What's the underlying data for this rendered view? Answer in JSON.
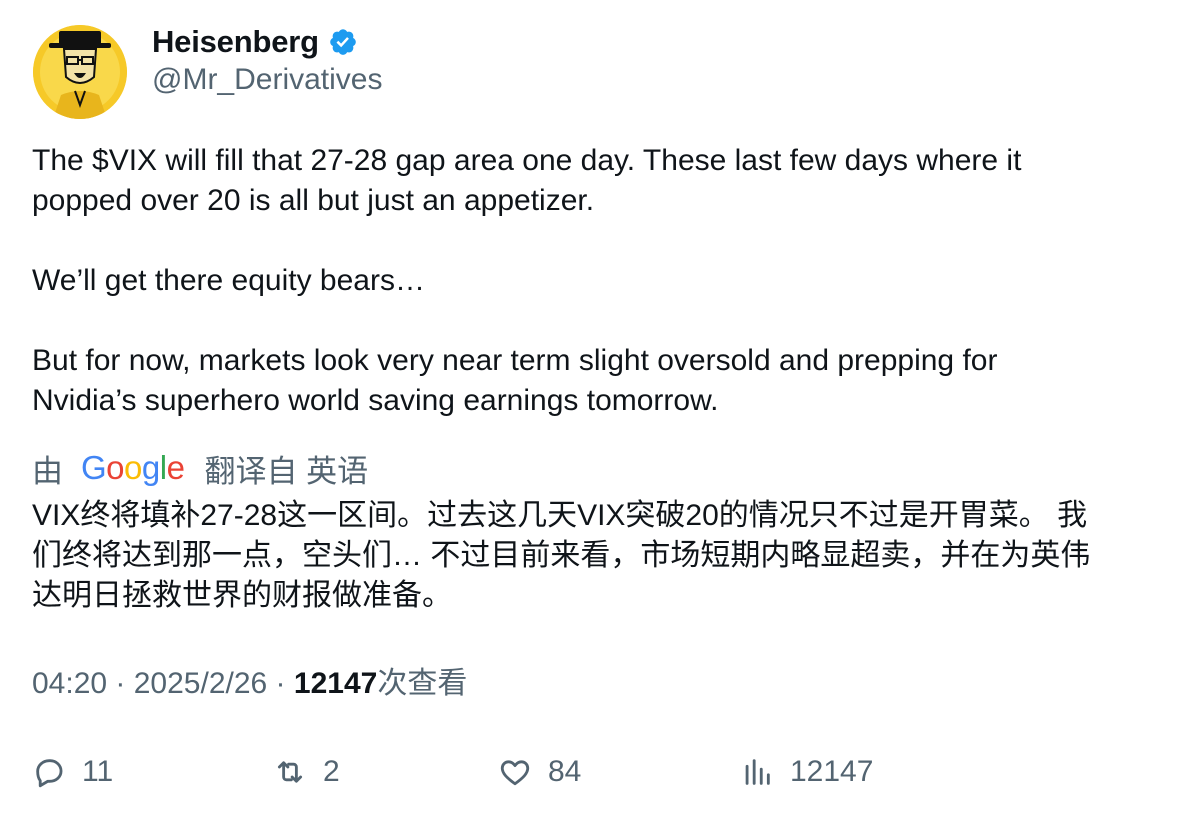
{
  "author": {
    "display_name": "Heisenberg",
    "handle": "@Mr_Derivatives",
    "verified": true,
    "verified_color": "#1d9bf0",
    "avatar_icon": "heisenberg-avatar"
  },
  "tweet": {
    "lines": [
      "The $VIX will fill that 27-28 gap area one day. These last few days where it",
      "popped over 20 is all but just an appetizer.",
      "",
      "We’ll get there equity bears…",
      "",
      "But for now, markets look very near term slight oversold and prepping for",
      "Nvidia’s superhero world saving earnings tomorrow."
    ]
  },
  "translation": {
    "prefix": "由",
    "provider": "Google",
    "suffix": "翻译自 英语",
    "lines": [
      "VIX终将填补27-28这一区间。过去这几天VIX突破20的情况只不过是开胃菜。 我",
      "们终将达到那一点，空头们… 不过目前来看，市场短期内略显超卖，并在为英伟",
      "达明日拯救世界的财报做准备。"
    ]
  },
  "meta": {
    "time": "04:20",
    "separator": " · ",
    "date": "2025/2/26",
    "views": "12147",
    "views_label": "次查看"
  },
  "actions": {
    "replies": "11",
    "retweets": "2",
    "likes": "84",
    "views": "12147"
  },
  "colors": {
    "text": "#0f1419",
    "secondary": "#536471",
    "google_blue": "#4285f4",
    "google_red": "#ea4335",
    "google_yellow": "#fbbc05",
    "google_green": "#34a853"
  }
}
